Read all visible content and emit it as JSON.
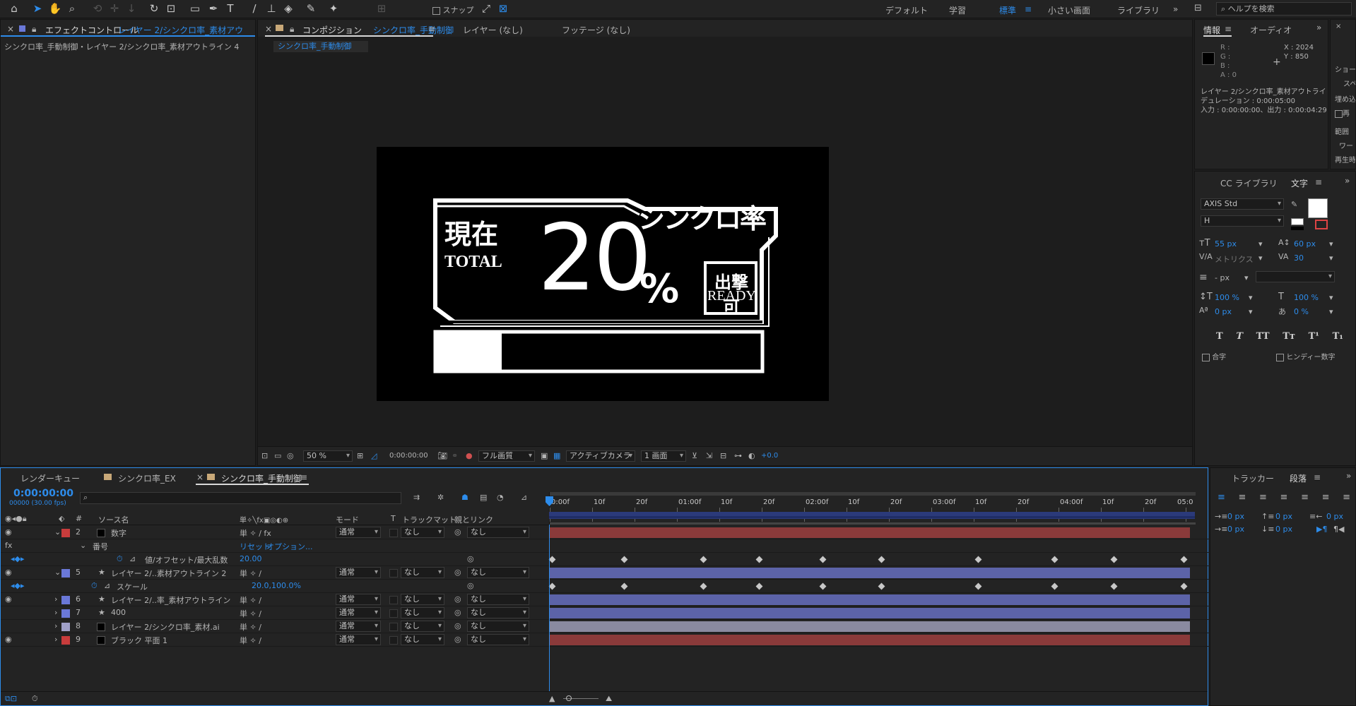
{
  "toolbar": {
    "snap_label": "スナップ",
    "workspaces": [
      "デフォルト",
      "学習",
      "標準",
      "小さい画面",
      "ライブラリ"
    ],
    "active_workspace": "標準",
    "search_placeholder": "ヘルプを検索"
  },
  "effect_panel": {
    "tab_title": "エフェクトコントロール",
    "tab_layer": "レイヤー 2/シンクロ率_素材アウトライ",
    "breadcrumb": "シンクロ率_手動制御・レイヤー 2/シンクロ率_素材アウトライン 4"
  },
  "comp_panel": {
    "tab_prefix": "コンポジション",
    "tab_comp": "シンクロ率_手動制御",
    "tab_layer": "レイヤー (なし)",
    "tab_footage": "フッテージ (なし)",
    "comp_chip": "シンクロ率_手動制御"
  },
  "viewer": {
    "zoom": "50 %",
    "timecode": "0:00:00:00",
    "quality": "フル画質",
    "camera": "アクティブカメラ",
    "views": "1 画面",
    "exposure": "+0.0"
  },
  "graphic": {
    "label_genzai": "現在",
    "label_total": "TOTAL",
    "big_number": "20",
    "percent": "%",
    "title": "シンクロ率",
    "ready_jp": "出撃可",
    "ready_en": "READY",
    "progress": 0.2
  },
  "info_panel": {
    "tab_info": "情報",
    "tab_audio": "オーディオ",
    "r": "R :",
    "g": "G :",
    "b": "B :",
    "a": "A : 0",
    "x": "X : 2024",
    "y": "Y : 850",
    "layer": "レイヤー 2/シンクロ率_素材アウトライン",
    "duration": "デュレーション : 0:00:05:00",
    "inout": "入力 : 0:00:00:00、出力 : 0:00:04:29"
  },
  "right_strip": {
    "items": [
      "ショー",
      "スペ",
      "埋め込",
      "再",
      "範囲",
      "ワー",
      "再生時"
    ]
  },
  "char_panel": {
    "tab_cc": "CC ライブラリ",
    "tab_char": "文字",
    "font": "AXIS Std",
    "style": "H",
    "size": "55 px",
    "leading": "60 px",
    "kerning": "メトリクス",
    "tracking": "30",
    "stroke": "- px",
    "vscale": "100 %",
    "hscale": "100 %",
    "baseline": "0 px",
    "tsume": "0 %",
    "styles": [
      "T",
      "T",
      "TT",
      "Tт",
      "T¹",
      "T₁"
    ],
    "ligature": "合字",
    "hindi": "ヒンディー数字"
  },
  "para_panel": {
    "tab_tracker": "トラッカー",
    "tab_para": "段落",
    "values": [
      "0 px",
      "0 px",
      "0 px",
      "0 px",
      "0 px"
    ]
  },
  "timeline": {
    "tab_render": "レンダーキュー",
    "tab_ex": "シンクロ率_EX",
    "tab_manual": "シンクロ率_手動制御",
    "timecode": "0:00:00:00",
    "fps": "00000 (30.00 fps)",
    "headers": {
      "num": "#",
      "source": "ソース名",
      "mode": "モード",
      "t": "T",
      "trackmat": "トラックマット",
      "parent": "親とリンク"
    },
    "ruler": [
      "0:00f",
      "10f",
      "20f",
      "01:00f",
      "10f",
      "20f",
      "02:00f",
      "10f",
      "20f",
      "03:00f",
      "10f",
      "20f",
      "04:00f",
      "10f",
      "20f",
      "05:0"
    ],
    "layers": [
      {
        "num": "2",
        "name": "数字",
        "mode": "通常",
        "track": "なし",
        "parent": "なし",
        "color": "#c83c3c",
        "star": false,
        "bar": "#8a3a3a"
      },
      {
        "num": "5",
        "name": "レイヤー 2/..素材アウトライン 2",
        "mode": "通常",
        "track": "なし",
        "parent": "なし",
        "color": "#6a78d8",
        "star": true,
        "bar": "#5c63a8"
      },
      {
        "num": "6",
        "name": "レイヤー 2/..率_素材アウトライン",
        "mode": "通常",
        "track": "なし",
        "parent": "なし",
        "color": "#6a78d8",
        "star": true,
        "bar": "#5c63a8"
      },
      {
        "num": "7",
        "name": "400",
        "mode": "通常",
        "track": "なし",
        "parent": "なし",
        "color": "#6a78d8",
        "star": true,
        "bar": "#5c63a8"
      },
      {
        "num": "8",
        "name": "レイヤー 2/シンクロ率_素材.ai",
        "mode": "通常",
        "track": "なし",
        "parent": "なし",
        "color": "#a0a0c8",
        "star": false,
        "bar": "#8a8aa0"
      },
      {
        "num": "9",
        "name": "ブラック 平面 1",
        "mode": "通常",
        "track": "なし",
        "parent": "なし",
        "color": "#c83c3c",
        "star": false,
        "bar": "#8a3a3a"
      }
    ],
    "fx_group": "番号",
    "fx_prop": "値/オフセット/最大乱数",
    "fx_reset": "リセット",
    "fx_option": "オプション...",
    "fx_value": "20.00",
    "scale_prop": "スケール",
    "scale_value": "20.0,100.0%"
  }
}
